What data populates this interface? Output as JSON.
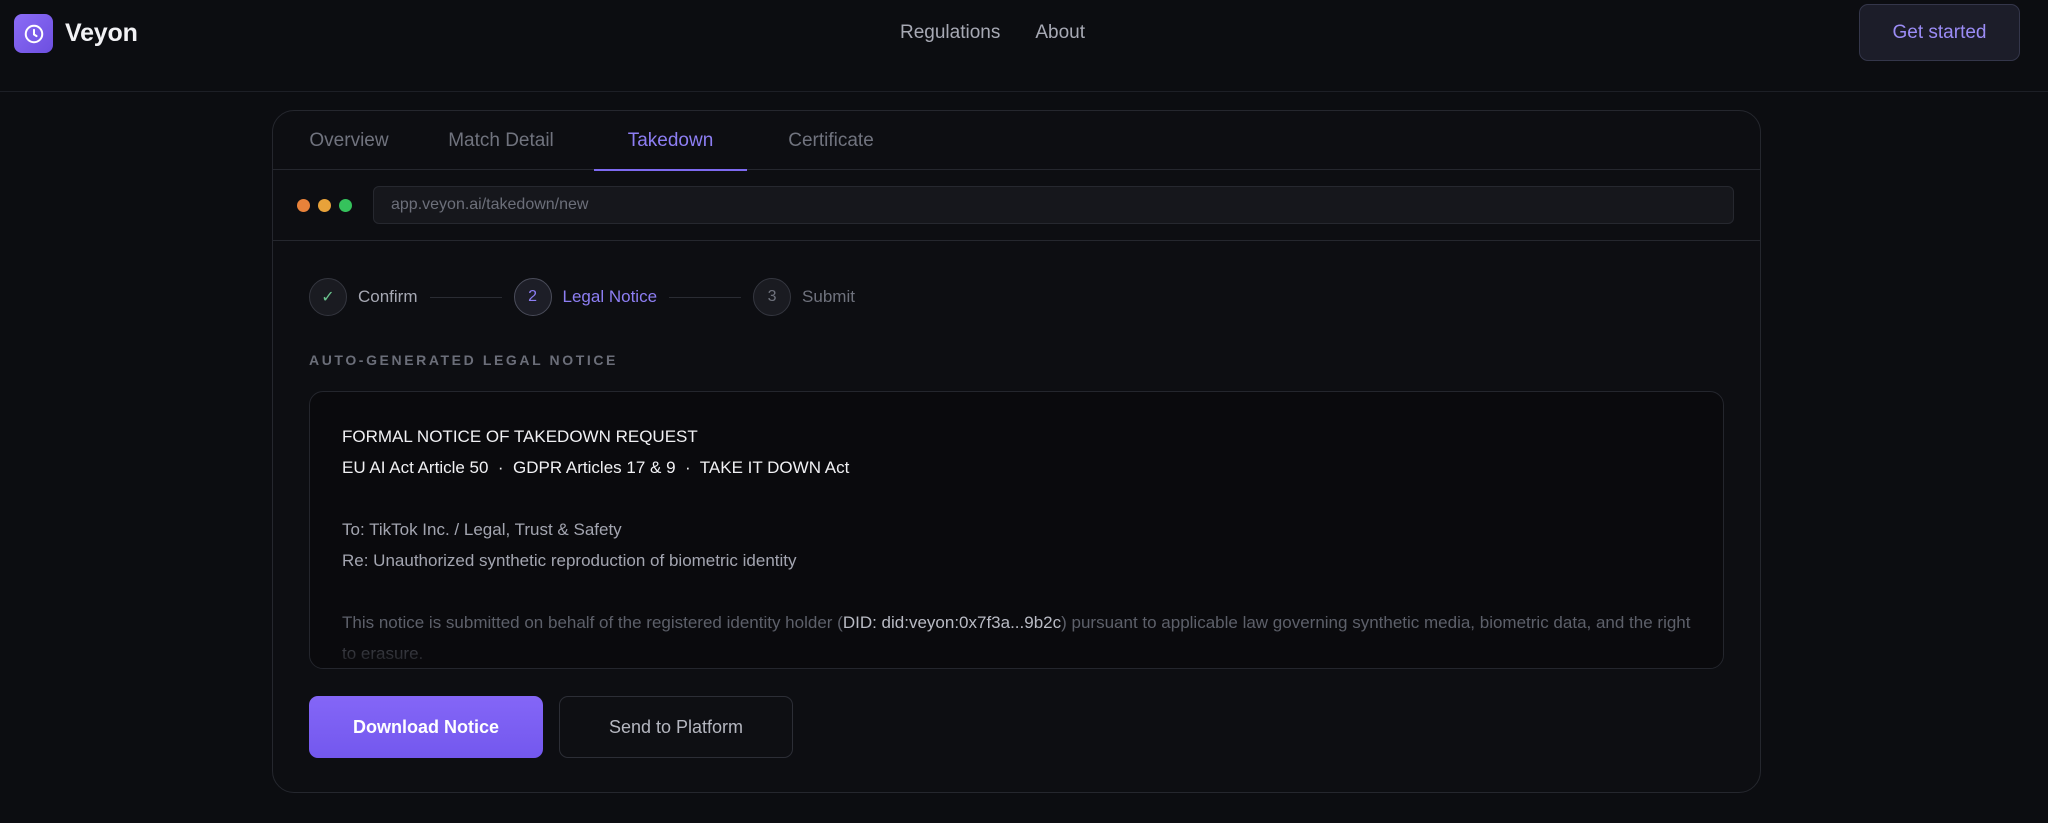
{
  "header": {
    "brand": "Veyon",
    "nav": [
      "Regulations",
      "About"
    ],
    "cta_label": "Get started"
  },
  "tabs": [
    {
      "label": "Overview",
      "active": false
    },
    {
      "label": "Match Detail",
      "active": false
    },
    {
      "label": "Takedown",
      "active": true
    },
    {
      "label": "Certificate",
      "active": false
    }
  ],
  "browser": {
    "url": "app.veyon.ai/takedown/new",
    "dot_colors": [
      "#e8823a",
      "#e8a23a",
      "#35c25c"
    ]
  },
  "stepper": {
    "steps": [
      {
        "marker": "✓",
        "label": "Confirm",
        "state": "done"
      },
      {
        "marker": "2",
        "label": "Legal Notice",
        "state": "current"
      },
      {
        "marker": "3",
        "label": "Submit",
        "state": "pending"
      }
    ]
  },
  "notice": {
    "section_label": "AUTO-GENERATED LEGAL NOTICE",
    "title": "FORMAL NOTICE OF TAKEDOWN REQUEST",
    "laws": "EU AI Act Article 50  ·  GDPR Articles 17 & 9  ·  TAKE IT DOWN Act",
    "to": "To: TikTok Inc. / Legal, Trust & Safety",
    "re": "Re: Unauthorized synthetic reproduction of biometric identity",
    "body_prefix": "This notice is submitted on behalf of the registered identity holder (",
    "body_did": "DID: did:veyon:0x7f3a...9b2c",
    "body_suffix": ") pursuant to applicable law governing synthetic media, biometric data, and the right to erasure."
  },
  "actions": {
    "download_label": "Download Notice",
    "send_label": "Send to Platform"
  },
  "colors": {
    "accent": "#7d6af0",
    "background": "#0c0d11",
    "success": "#6ac28d"
  }
}
